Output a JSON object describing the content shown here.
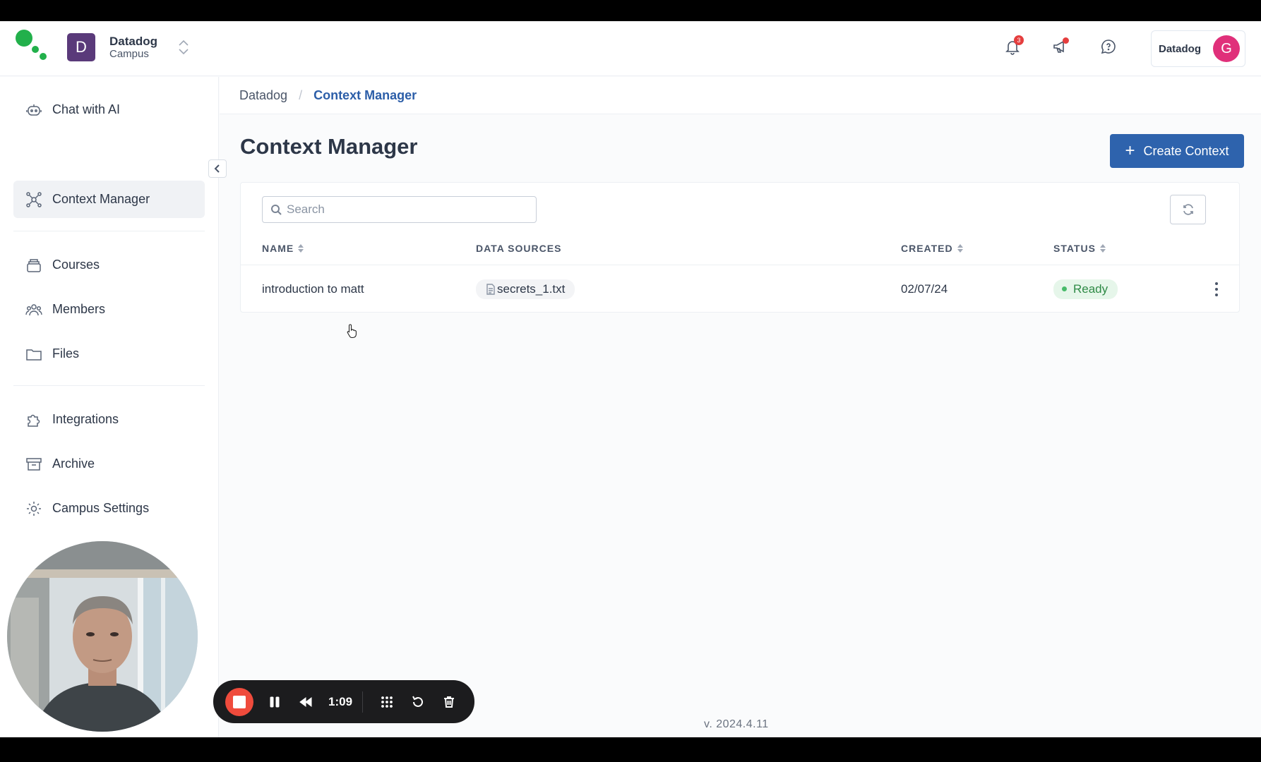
{
  "org": {
    "initial": "D",
    "name": "Datadog",
    "subtitle": "Campus"
  },
  "header": {
    "notification_count": "3",
    "user_label": "Datadog",
    "user_initial": "G"
  },
  "sidebar": {
    "items": [
      {
        "label": "Chat with AI",
        "icon": "robot-icon"
      },
      {
        "label": "Context Manager",
        "icon": "network-icon",
        "active": true
      },
      {
        "label": "Courses",
        "icon": "stack-icon"
      },
      {
        "label": "Members",
        "icon": "users-icon"
      },
      {
        "label": "Files",
        "icon": "folder-icon"
      },
      {
        "label": "Integrations",
        "icon": "puzzle-icon"
      },
      {
        "label": "Archive",
        "icon": "archive-icon"
      },
      {
        "label": "Campus Settings",
        "icon": "gear-icon"
      }
    ]
  },
  "breadcrumb": {
    "root": "Datadog",
    "current": "Context Manager"
  },
  "page": {
    "title": "Context Manager",
    "create_label": "Create Context"
  },
  "search": {
    "placeholder": "Search"
  },
  "table": {
    "headers": {
      "name": "NAME",
      "data_sources": "DATA SOURCES",
      "created": "CREATED",
      "status": "STATUS"
    },
    "rows": [
      {
        "name": "introduction to matt",
        "data_source": "secrets_1.txt",
        "created": "02/07/24",
        "status": "Ready"
      }
    ]
  },
  "footer": {
    "version": "v. 2024.4.11"
  },
  "recorder": {
    "elapsed": "1:09"
  },
  "colors": {
    "primary": "#2e63ad",
    "status_ready_bg": "#e6f6ea",
    "status_ready_text": "#2f8a46",
    "record_red": "#ef4b3c",
    "avatar_pink": "#e0307a",
    "org_purple": "#5a3a7a"
  }
}
